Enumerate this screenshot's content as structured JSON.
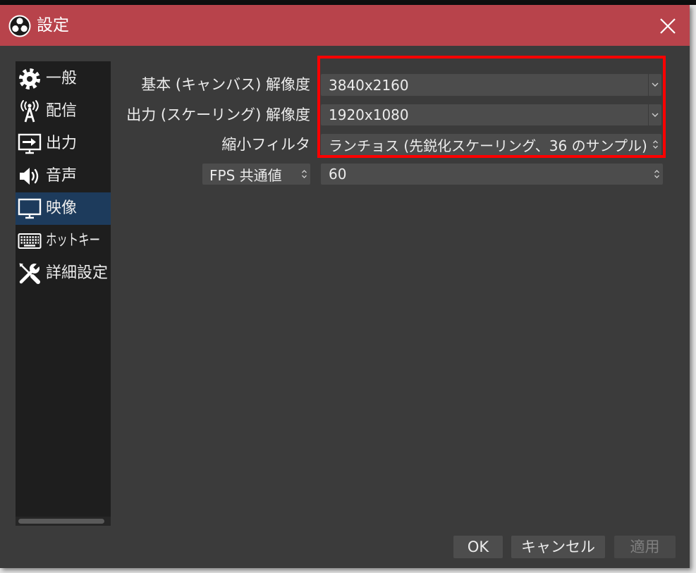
{
  "window": {
    "title": "設定",
    "logo_icon": "obs-logo-icon",
    "close_icon": "close-icon"
  },
  "colors": {
    "titlebar": "#b8434b",
    "body": "#3b3b3b",
    "sidebar": "#1e1e1e",
    "selected": "#1d3b5c",
    "field": "#4c4c4c",
    "button": "#4d4d4d",
    "highlight": "#ff0000",
    "text": "#ececec",
    "disabled_text": "#808080"
  },
  "sidebar": {
    "items": [
      {
        "label": "一般",
        "icon": "gear-icon"
      },
      {
        "label": "配信",
        "icon": "broadcast-antenna-icon"
      },
      {
        "label": "出力",
        "icon": "output-monitor-icon"
      },
      {
        "label": "音声",
        "icon": "speaker-icon"
      },
      {
        "label": "映像",
        "icon": "monitor-icon",
        "selected": true
      },
      {
        "label": "ホットキー",
        "icon": "keyboard-icon"
      },
      {
        "label": "詳細設定",
        "icon": "tools-icon"
      }
    ]
  },
  "video": {
    "base_resolution": {
      "label": "基本 (キャンバス) 解像度",
      "value": "3840x2160"
    },
    "output_resolution": {
      "label": "出力 (スケーリング) 解像度",
      "value": "1920x1080"
    },
    "downscale_filter": {
      "label": "縮小フィルタ",
      "value": "ランチョス (先鋭化スケーリング、36 のサンプル)"
    },
    "fps": {
      "type": "FPS 共通値",
      "value": "60"
    }
  },
  "buttons": {
    "ok": "OK",
    "cancel": "キャンセル",
    "apply": "適用",
    "apply_enabled": false
  }
}
